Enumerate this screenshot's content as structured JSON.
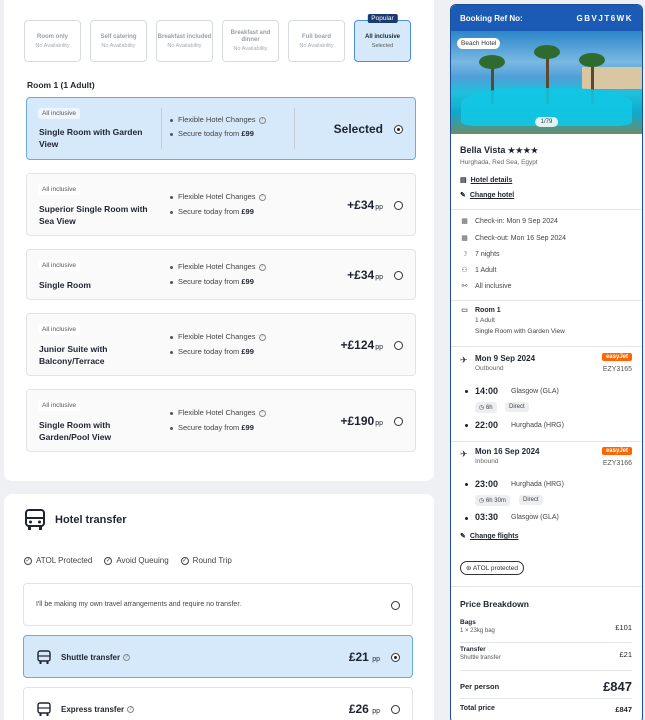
{
  "boards": [
    {
      "name": "Room only",
      "avail": "No Availability"
    },
    {
      "name": "Self catering",
      "avail": "No Availability"
    },
    {
      "name": "Breakfast included",
      "avail": "No Availability"
    },
    {
      "name": "Breakfast and dinner",
      "avail": "No Availability"
    },
    {
      "name": "Full board",
      "avail": "No Availability"
    },
    {
      "name": "All inclusive",
      "avail": "Selected",
      "badge": "Popular"
    }
  ],
  "room_heading": "Room 1 (1 Adult)",
  "rooms": [
    {
      "tag": "All inclusive",
      "name": "Single Room with Garden View",
      "feat1": "Flexible Hotel Changes",
      "feat2_prefix": "Secure today from ",
      "feat2_price": "£99",
      "status": "Selected"
    },
    {
      "tag": "All inclusive",
      "name": "Superior Single Room with Sea View",
      "feat1": "Flexible Hotel Changes",
      "feat2_prefix": "Secure today from ",
      "feat2_price": "£99",
      "price": "+£34",
      "unit": "pp"
    },
    {
      "tag": "All inclusive",
      "name": "Single Room",
      "feat1": "Flexible Hotel Changes",
      "feat2_prefix": "Secure today from ",
      "feat2_price": "£99",
      "price": "+£34",
      "unit": "pp"
    },
    {
      "tag": "All inclusive",
      "name": "Junior Suite with Balcony/Terrace",
      "feat1": "Flexible Hotel Changes",
      "feat2_prefix": "Secure today from ",
      "feat2_price": "£99",
      "price": "+£124",
      "unit": "pp"
    },
    {
      "tag": "All inclusive",
      "name": "Single Room with Garden/Pool View",
      "feat1": "Flexible Hotel Changes",
      "feat2_prefix": "Secure today from ",
      "feat2_price": "£99",
      "price": "+£190",
      "unit": "pp"
    }
  ],
  "transfer": {
    "title": "Hotel transfer",
    "features": [
      "ATOL Protected",
      "Avoid Queuing",
      "Round Trip"
    ],
    "own_arrangements": "I'll be making my own travel arrangements and require no transfer.",
    "options": [
      {
        "label": "Shuttle transfer",
        "price": "£21",
        "unit": "pp"
      },
      {
        "label": "Express transfer",
        "price": "£26",
        "unit": "pp"
      }
    ]
  },
  "summary": {
    "ref_label": "Booking Ref No:",
    "ref_code": "GBVJT6WK",
    "image_badge": "Beach Hotel",
    "image_counter": "1/79",
    "hotel_name": "Bella Vista",
    "stars": "★★★★",
    "location": "Hurghada, Red Sea, Egypt",
    "hotel_details": "Hotel details",
    "change_hotel": "Change hotel",
    "check_in": "Check-in: Mon 9 Sep 2024",
    "check_out": "Check-out: Mon 16 Sep 2024",
    "nights": "7 nights",
    "adults": "1 Adult",
    "board": "All inclusive",
    "room_title": "Room 1",
    "room_adults": "1 Adult",
    "room_type": "Single Room with Garden View",
    "outbound": {
      "date": "Mon 9 Sep 2024",
      "dir": "Outbound",
      "airline": "easyJet",
      "code": "EZY3165",
      "dep_time": "14:00",
      "dep_place": "Glasgow (GLA)",
      "duration": "6h",
      "stops": "Direct",
      "arr_time": "22:00",
      "arr_place": "Hurghada (HRG)"
    },
    "inbound": {
      "date": "Mon 16 Sep 2024",
      "dir": "Inbound",
      "airline": "easyJet",
      "code": "EZY3166",
      "dep_time": "23:00",
      "dep_place": "Hurghada (HRG)",
      "duration": "6h 30m",
      "stops": "Direct",
      "arr_time": "03:30",
      "arr_place": "Glasgow (GLA)"
    },
    "change_flights": "Change flights",
    "atol": "ATOL protected",
    "price_title": "Price Breakdown",
    "bags_label": "Bags",
    "bags_sub": "1 × 23kg bag",
    "bags_price": "£101",
    "transfer_label": "Transfer",
    "transfer_sub": "Shuttle transfer",
    "transfer_price": "£21",
    "per_person_label": "Per person",
    "per_person": "£847",
    "total_label": "Total price",
    "total": "£847"
  }
}
